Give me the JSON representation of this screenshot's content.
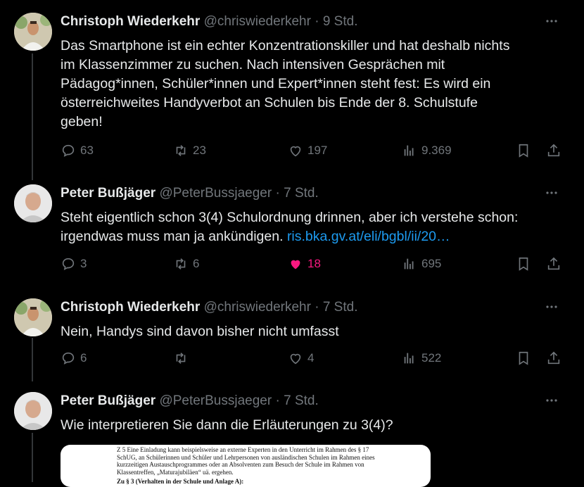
{
  "tweets": [
    {
      "name": "Christoph Wiederkehr",
      "handle": "@chriswiederkehr",
      "time": "9 Std.",
      "lines": [
        "Das Smartphone ist ein echter Konzentrationskiller und hat deshalb nichts",
        "im Klassenzimmer zu suchen. Nach intensiven Gesprächen mit",
        "Pädagog*innen, Schüler*innen und Expert*innen steht fest: Es wird ein",
        "österreichweites Handyverbot an Schulen bis Ende der 8. Schulstufe",
        "geben!"
      ],
      "replies": "63",
      "reposts": "23",
      "likes": "197",
      "views": "9.369"
    },
    {
      "name": "Peter Bußjäger",
      "handle": "@PeterBussjaeger",
      "time": "7 Std.",
      "lines": [
        "Steht eigentlich schon 3(4) Schulordnung drinnen, aber ich verstehe schon:",
        "irgendwas muss man ja ankündigen. "
      ],
      "link": "ris.bka.gv.at/eli/bgbl/ii/20…",
      "replies": "3",
      "reposts": "6",
      "likes": "18",
      "views": "695"
    },
    {
      "name": "Christoph Wiederkehr",
      "handle": "@chriswiederkehr",
      "time": "7 Std.",
      "lines": [
        "Nein, Handys sind davon bisher nicht umfasst"
      ],
      "replies": "6",
      "reposts": "",
      "likes": "4",
      "views": "522"
    },
    {
      "name": "Peter Bußjäger",
      "handle": "@PeterBussjaeger",
      "time": "7 Std.",
      "lines": [
        "Wie interpretieren Sie dann die Erläuterungen zu 3(4)?"
      ]
    }
  ],
  "attachment": {
    "lines": [
      "Z 5 Eine Einladung kann beispielsweise an externe Experten in den Unterricht im Rahmen des § 17",
      "SchUG, an Schülerinnen und Schüler und Lehrpersonen von ausländischen Schulen im Rahmen eines",
      "kurzzeitigen Austauschprogrammes oder an Absolventen zum Besuch der Schule im Rahmen von",
      "Klassentreffen, „Maturajubiläen“ uä. ergehen."
    ],
    "heading": "Zu § 3 (Verhalten in der Schule und Anlage A):"
  },
  "icons": [
    "more-icon",
    "reply-icon",
    "repost-icon",
    "like-icon",
    "views-icon",
    "bookmark-icon",
    "share-icon"
  ],
  "colors": {
    "like_active": "#f91880",
    "link": "#1d9bf0",
    "muted": "#71767b"
  }
}
